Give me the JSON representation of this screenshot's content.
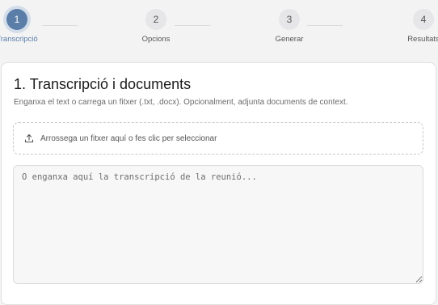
{
  "stepper": {
    "steps": [
      {
        "number": "1",
        "label": "Transcripció",
        "active": true
      },
      {
        "number": "2",
        "label": "Opcions",
        "active": false
      },
      {
        "number": "3",
        "label": "Generar",
        "active": false
      },
      {
        "number": "4",
        "label": "Resultats",
        "active": false
      }
    ],
    "active_color": "#5a7ea8"
  },
  "card": {
    "title": "1. Transcripció i documents",
    "description": "Enganxa el text o carrega un fitxer (.txt, .docx). Opcionalment, adjunta documents de context.",
    "dropzone": {
      "icon": "upload-icon",
      "text": "Arrossega un fitxer aquí o fes clic per seleccionar"
    },
    "transcript": {
      "value": "",
      "placeholder": "O enganxa aquí la transcripció de la reunió..."
    }
  }
}
